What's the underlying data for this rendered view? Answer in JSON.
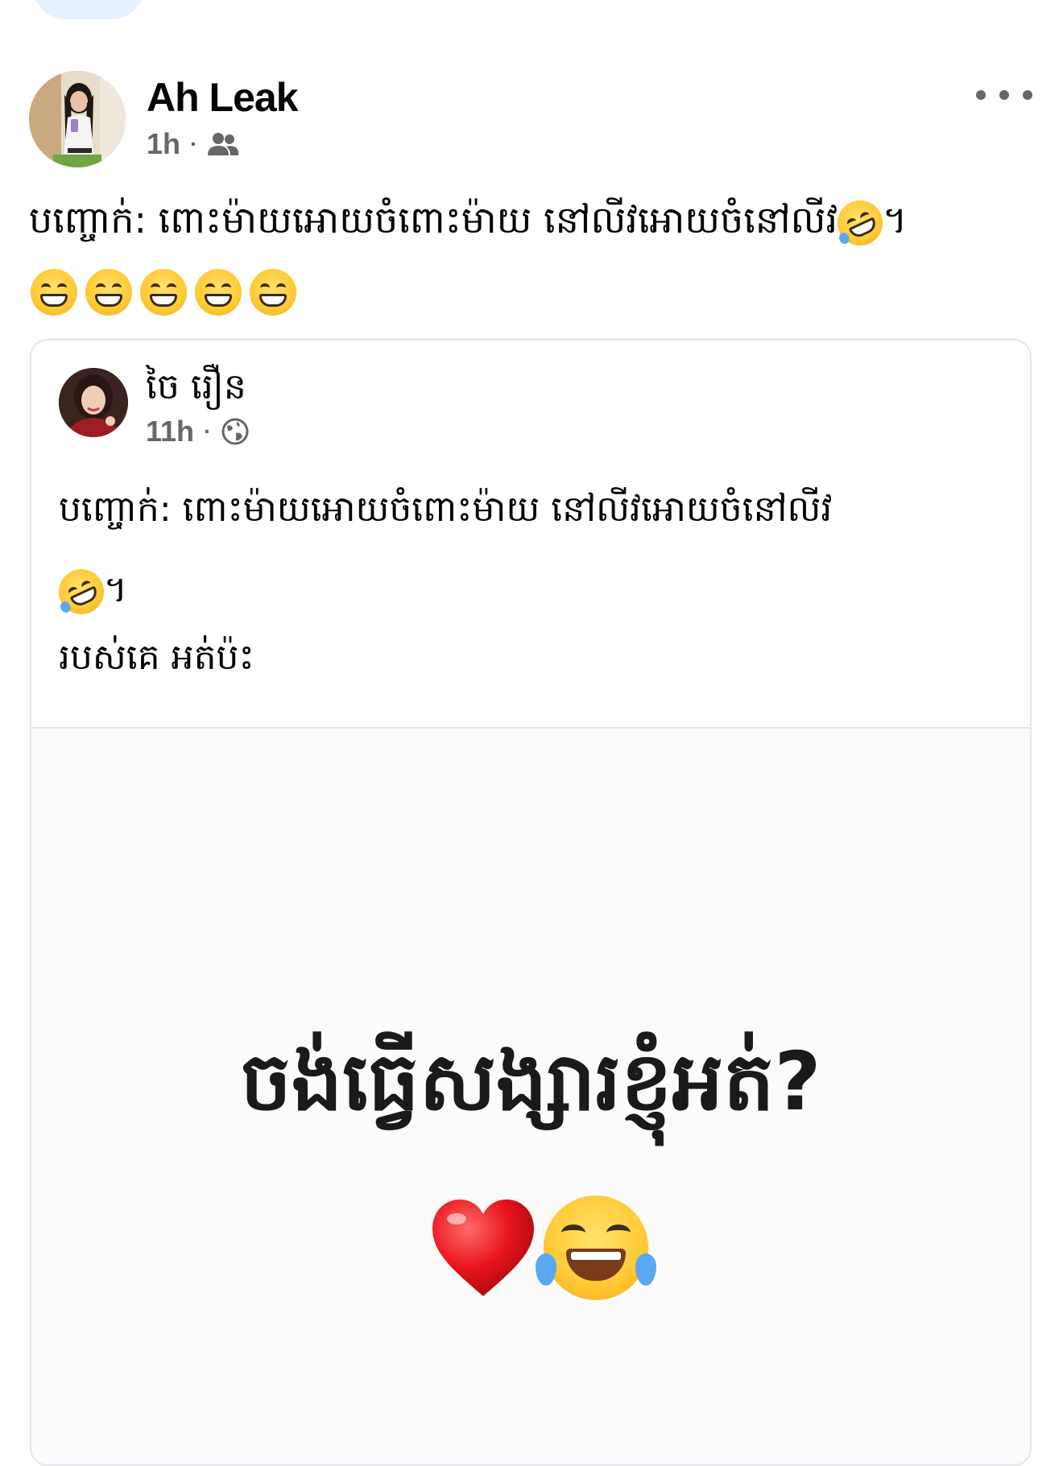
{
  "post": {
    "author": "Ah Leak",
    "time": "1h",
    "separator": "·",
    "audience_icon": "friends-icon",
    "more_icon": "more-options-icon",
    "text": "បញ្ចោក់: ពោះម៉ាយអោយចំពោះម៉ាយ នៅលីវអោយចំនៅលីវ",
    "text_end_emoji": "rolling-on-floor-laughing-emoji",
    "text_suffix": "។",
    "emoji_row": [
      "grinning-face-emoji",
      "grinning-face-emoji",
      "grinning-face-emoji",
      "grinning-face-emoji",
      "grinning-face-emoji"
    ]
  },
  "shared_post": {
    "author": "ចៃ រឿន",
    "time": "11h",
    "separator": "·",
    "audience_icon": "globe-icon",
    "text": "បញ្ចោក់: ពោះម៉ាយអោយចំពោះម៉ាយ នៅលីវអោយចំនៅលីវ",
    "text_end_emoji": "rolling-on-floor-laughing-emoji",
    "text_suffix": "។",
    "caption": "របស់គេ អត់ប៉ះ",
    "image": {
      "text": "ចង់ធ្វើសង្សារខ្ញុំអត់?",
      "emojis": [
        "red-heart-emoji",
        "face-with-tears-of-joy-emoji"
      ]
    }
  },
  "colors": {
    "text": "#050505",
    "secondary": "#65676b",
    "border": "#e4e6eb",
    "top_pill": "#e7f0fd"
  }
}
